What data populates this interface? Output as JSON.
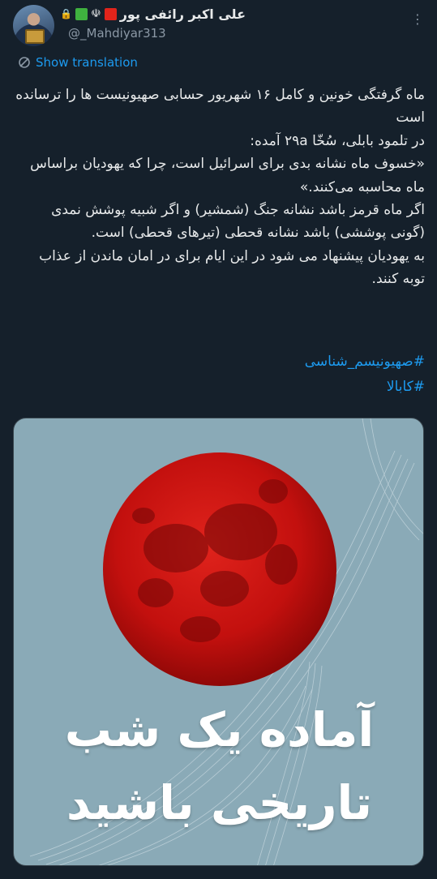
{
  "author": {
    "display_name": "علی اکبر رائفی پور",
    "handle": "@_Mahdiyar313",
    "badges": [
      "lock-icon",
      "flag-green",
      "emblem-icon",
      "flag-red"
    ]
  },
  "translate": {
    "label": "Show translation"
  },
  "tweet": {
    "lines": [
      "ماه گرفتگی خونین و کامل ۱۶ شهریور حسابی صهیونیست ها را ترسانده است",
      "در تلمود بابلی، سُخّا ۲۹a آمده:",
      "«خسوف ماه نشانه بدی برای اسرائیل است، چرا که یهودیان براساس ماه محاسبه می‌کنند.»",
      "اگر ماه قرمز باشد نشانه جنگ (شمشیر) و اگر شبیه پوشش نمدی (گونی پوششی) باشد نشانه قحطی (تیرهای قحطی) است.",
      "به یهودیان پیشنهاد می شود در این ایام برای در امان ماندن از عذاب توبه کنند."
    ],
    "hashtags": [
      "#صهیونیسم_شناسی",
      "#کابالا"
    ]
  },
  "media": {
    "title_line1": "آماده یک شب",
    "title_line2": "تاریخی باشید",
    "background_color": "#8aaab7",
    "moon_color": "#c9110f"
  },
  "colors": {
    "background": "#15202b",
    "link": "#1d9bf0",
    "text": "#e7e9ea",
    "secondary": "#8b98a5"
  }
}
